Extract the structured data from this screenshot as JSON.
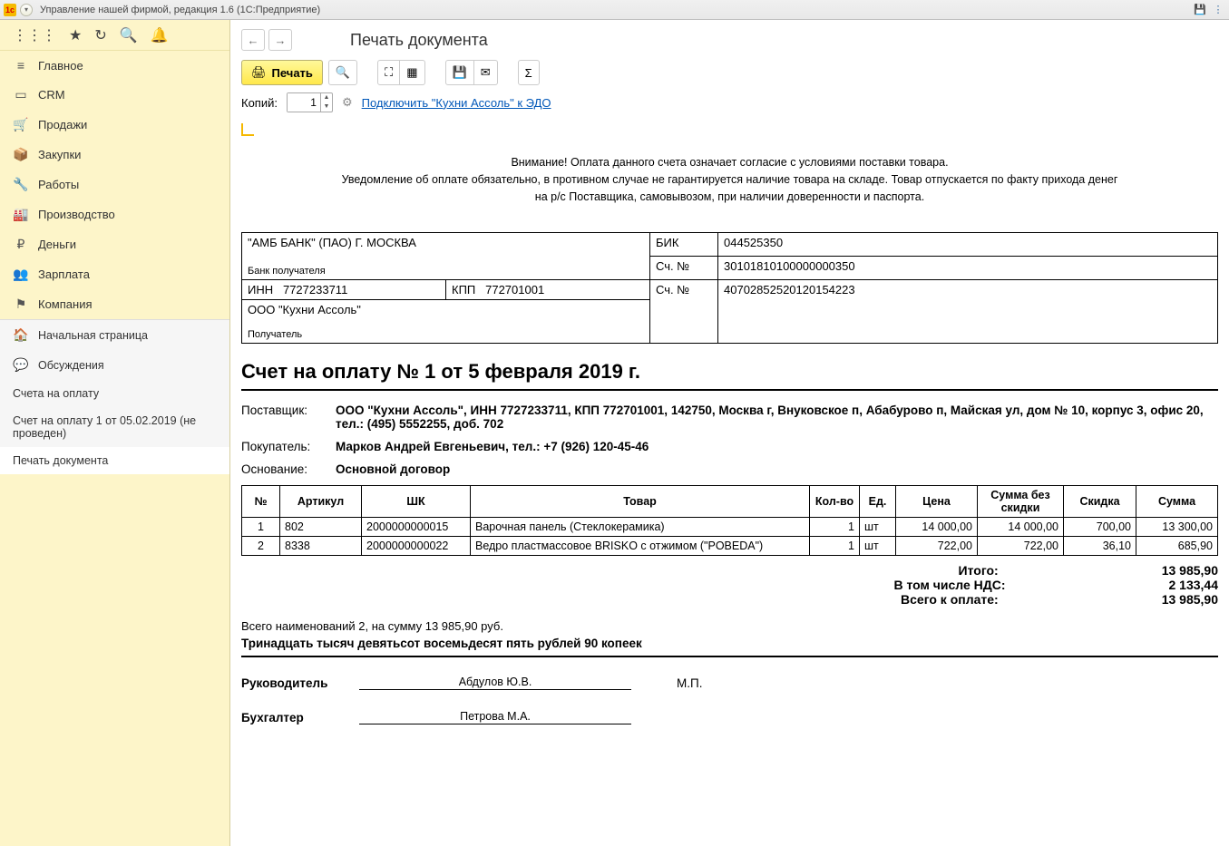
{
  "window_title": "Управление нашей фирмой, редакция 1.6  (1С:Предприятие)",
  "sidebar": {
    "main_items": [
      {
        "icon": "≡",
        "label": "Главное"
      },
      {
        "icon": "crm",
        "label": "CRM"
      },
      {
        "icon": "cart",
        "label": "Продажи"
      },
      {
        "icon": "box",
        "label": "Закупки"
      },
      {
        "icon": "wrench",
        "label": "Работы"
      },
      {
        "icon": "factory",
        "label": "Производство"
      },
      {
        "icon": "ruble",
        "label": "Деньги"
      },
      {
        "icon": "people",
        "label": "Зарплата"
      },
      {
        "icon": "flag",
        "label": "Компания"
      }
    ],
    "secondary_items": [
      {
        "icon": "home",
        "label": "Начальная страница"
      },
      {
        "icon": "chat",
        "label": "Обсуждения"
      },
      {
        "icon": "",
        "label": "Счета на оплату"
      },
      {
        "icon": "",
        "label": "Счет на оплату 1 от 05.02.2019 (не проведен)"
      },
      {
        "icon": "",
        "label": "Печать документа",
        "active": true
      }
    ]
  },
  "page_title": "Печать документа",
  "toolbar": {
    "print_label": "Печать",
    "copies_label": "Копий:",
    "copies_value": "1",
    "edo_link": "Подключить \"Кухни Ассоль\" к ЭДО"
  },
  "notice": {
    "line1": "Внимание! Оплата данного счета означает согласие с условиями поставки товара.",
    "line2": "Уведомление об оплате обязательно, в противном случае не гарантируется наличие товара на складе. Товар отпускается по факту прихода денег",
    "line3": "на р/с Поставщика, самовывозом, при наличии доверенности и паспорта."
  },
  "bank": {
    "bank_name": "\"АМБ БАНК\" (ПАО) Г. МОСКВА",
    "bank_recipient_label": "Банк получателя",
    "bik_label": "БИК",
    "bik": "044525350",
    "acc1_label": "Сч. №",
    "acc1": "30101810100000000350",
    "inn_label": "ИНН",
    "inn": "7727233711",
    "kpp_label": "КПП",
    "kpp": "772701001",
    "acc2_label": "Сч. №",
    "acc2": "40702852520120154223",
    "org": "ООО \"Кухни Ассоль\"",
    "recipient_label": "Получатель"
  },
  "doc_title": "Счет на оплату № 1 от 5 февраля 2019 г.",
  "info": {
    "supplier_label": "Поставщик:",
    "supplier": "ООО \"Кухни Ассоль\",  ИНН 7727233711,  КПП 772701001,  142750, Москва г, Внуковское п, Абабурово п, Майская ул, дом № 10, корпус 3, офис 20,  тел.: (495) 5552255, доб. 702",
    "buyer_label": "Покупатель:",
    "buyer": "Марков Андрей Евгеньевич,  тел.: +7 (926) 120-45-46",
    "basis_label": "Основание:",
    "basis": "Основной договор"
  },
  "items": {
    "headers": {
      "num": "№",
      "sku": "Артикул",
      "barcode": "ШК",
      "name": "Товар",
      "qty": "Кол-во",
      "unit": "Ед.",
      "price": "Цена",
      "sum_nodisc": "Сумма без скидки",
      "discount": "Скидка",
      "sum": "Сумма"
    },
    "rows": [
      {
        "n": "1",
        "sku": "802",
        "bc": "2000000000015",
        "name": "Варочная панель (Стеклокерамика)",
        "qty": "1",
        "unit": "шт",
        "price": "14 000,00",
        "snd": "14 000,00",
        "disc": "700,00",
        "sum": "13 300,00"
      },
      {
        "n": "2",
        "sku": "8338",
        "bc": "2000000000022",
        "name": "Ведро пластмассовое BRISKO с отжимом (\"POBEDA\")",
        "qty": "1",
        "unit": "шт",
        "price": "722,00",
        "snd": "722,00",
        "disc": "36,10",
        "sum": "685,90"
      }
    ]
  },
  "totals": {
    "itogo_label": "Итого:",
    "itogo": "13 985,90",
    "nds_label": "В том числе НДС:",
    "nds": "2 133,44",
    "pay_label": "Всего к оплате:",
    "pay": "13 985,90"
  },
  "summary": "Всего наименований 2, на сумму 13 985,90 руб.",
  "summary_words": "Тринадцать тысяч девятьсот восемьдесят пять рублей 90 копеек",
  "signatures": {
    "head_label": "Руководитель",
    "head_name": "Абдулов Ю.В.",
    "mp": "М.П.",
    "acc_label": "Бухгалтер",
    "acc_name": "Петрова М.А."
  }
}
